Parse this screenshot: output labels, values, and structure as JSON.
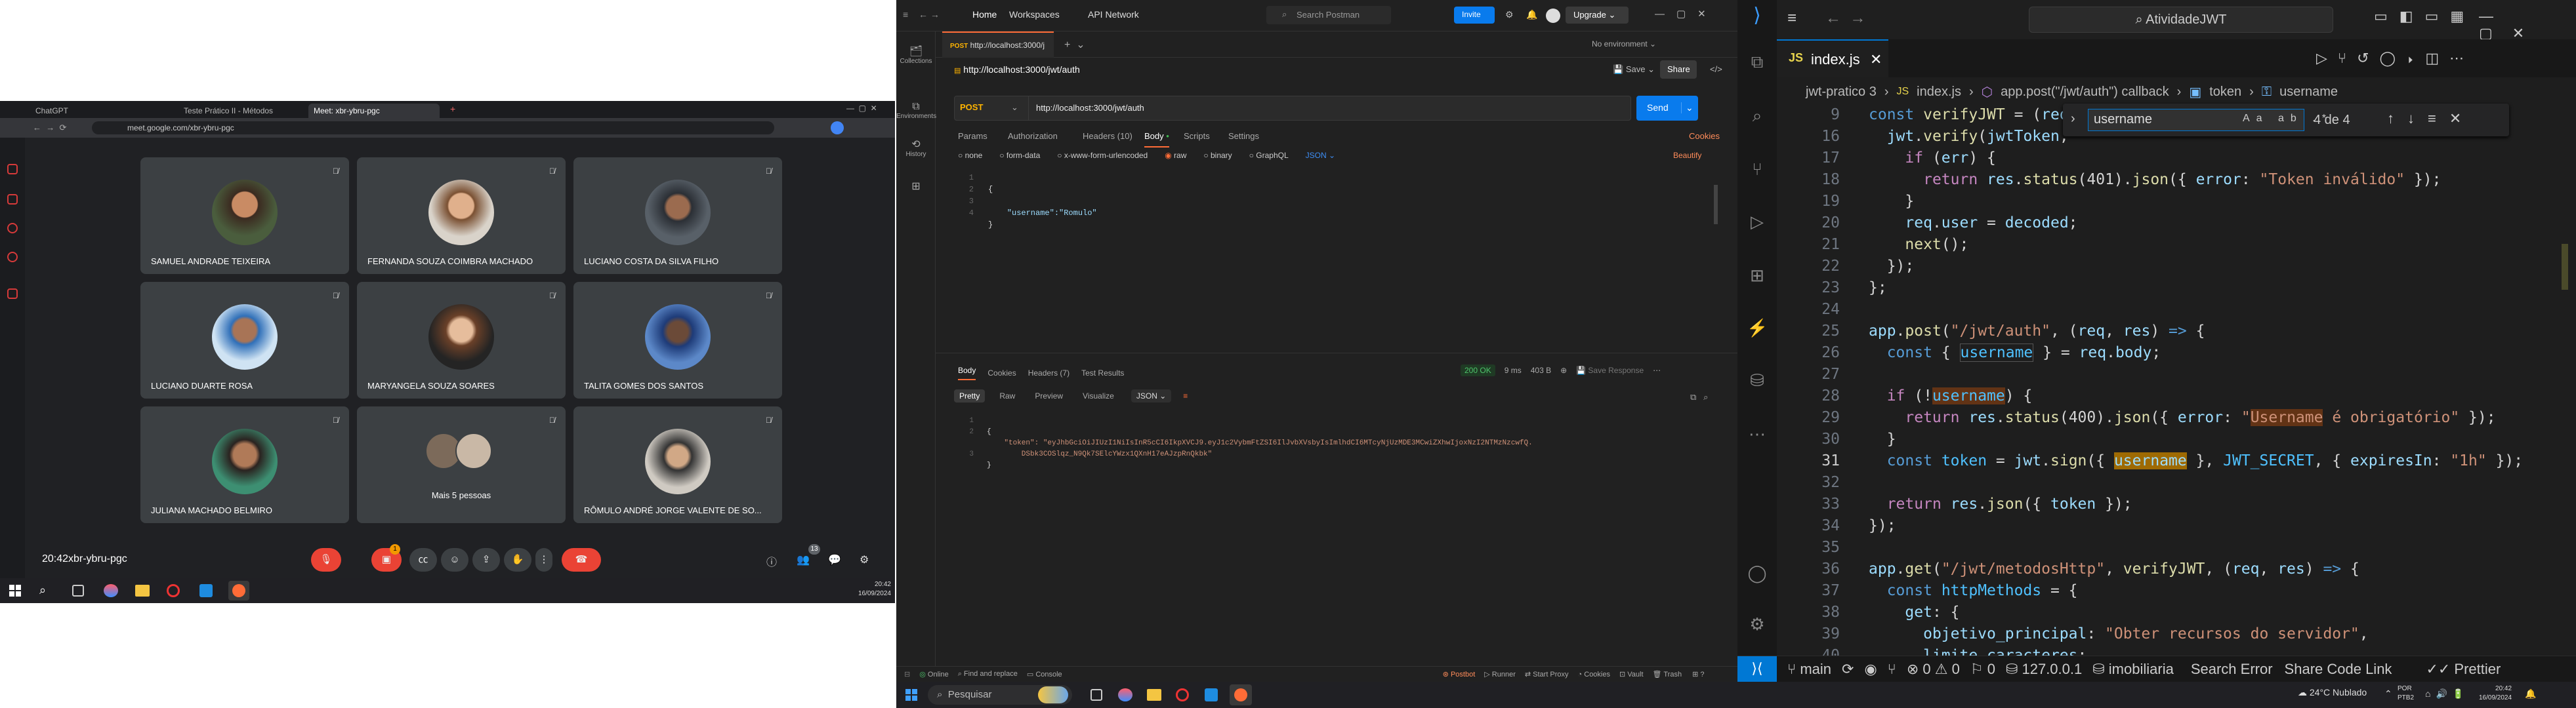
{
  "meet": {
    "tabs": [
      "ChatGPT",
      "Teste Prático II - Métodos",
      "Meet: xbr-ybru-pgc"
    ],
    "url": "meet.google.com/xbr-ybru-pgc",
    "participants": [
      "SAMUEL ANDRADE TEIXEIRA",
      "FERNANDA SOUZA COIMBRA MACHADO",
      "LUCIANO COSTA DA SILVA FILHO",
      "LUCIANO DUARTE ROSA",
      "MARYANGELA SOUZA SOARES",
      "TALITA GOMES DOS SANTOS",
      "JULIANA MACHADO BELMIRO",
      "Mais 5 pessoas",
      "RÔMULO ANDRÉ JORGE VALENTE DE SO..."
    ],
    "time": "20:42",
    "meeting_code": "xbr-ybru-pgc",
    "reactions_badge": "1",
    "people_count": "13"
  },
  "taskbar_left": {
    "time": "20:42",
    "date": "16/09/2024"
  },
  "postman": {
    "nav": {
      "home": "Home",
      "workspaces": "Workspaces",
      "api_network": "API Network",
      "search": "Search Postman",
      "invite": "Invite",
      "upgrade": "Upgrade"
    },
    "tab": {
      "method": "POST",
      "title": "http://localhost:3000/j",
      "env": "No environment"
    },
    "sidebar": [
      "Collections",
      "Environments",
      "History"
    ],
    "request_title": "http://localhost:3000/jwt/auth",
    "save": "Save",
    "share": "Share",
    "method": "POST",
    "url": "http://localhost:3000/jwt/auth",
    "send": "Send",
    "req_tabs": [
      "Params",
      "Authorization",
      "Headers (10)",
      "Body",
      "Scripts",
      "Settings"
    ],
    "cookies": "Cookies",
    "body_types": [
      "none",
      "form-data",
      "x-www-form-urlencoded",
      "raw",
      "binary",
      "GraphQL"
    ],
    "json_label": "JSON",
    "beautify": "Beautify",
    "body_lines": [
      "{",
      "",
      "    \"username\":\"Romulo\"",
      "}"
    ],
    "resp_tabs": [
      "Body",
      "Cookies",
      "Headers (7)",
      "Test Results"
    ],
    "status": "200 OK",
    "time": "9 ms",
    "size": "403 B",
    "save_response": "Save Response",
    "view_tabs": [
      "Pretty",
      "Raw",
      "Preview",
      "Visualize"
    ],
    "resp_format": "JSON",
    "resp_lines": [
      "{",
      "    \"token\": \"eyJhbGciOiJIUzI1NiIsInR5cCI6IkpXVCJ9.eyJ1c2VybmFtZSI6IlJvbXVsbyIsImlhdCI6MTcyNjUzMDE3MCwiZXhwIjoxNzI2NTMzNzcwfQ.",
      "        DSbk3COSlqz_N9Qk7SElcYWzx1QXnH17eAJzpRnQkbk\"",
      "}"
    ],
    "footer": [
      "Online",
      "Find and replace",
      "Console",
      "Postbot",
      "Runner",
      "Start Proxy",
      "Cookies",
      "Vault",
      "Trash"
    ]
  },
  "taskbar_mid": {
    "search": "Pesquisar"
  },
  "vscode": {
    "search": "AtividadeJWT",
    "tab": "index.js",
    "breadcrumb": [
      "jwt-pratico 3",
      "index.js",
      "app.post(\"/jwt/auth\") callback",
      "token",
      "username"
    ],
    "find_term": "username",
    "find_count": "4 de 4",
    "code": [
      {
        "n": "9",
        "t": "  const verifyJWT = (req,"
      },
      {
        "n": "16",
        "t": "    jwt.verify(jwtToken,"
      },
      {
        "n": "17",
        "t": "      if (err) {"
      },
      {
        "n": "18",
        "t": "        return res.status(401).json({ error: \"Token inválido\" });"
      },
      {
        "n": "19",
        "t": "      }"
      },
      {
        "n": "20",
        "t": "      req.user = decoded;"
      },
      {
        "n": "21",
        "t": "      next();"
      },
      {
        "n": "22",
        "t": "    });"
      },
      {
        "n": "23",
        "t": "  };"
      },
      {
        "n": "24",
        "t": ""
      },
      {
        "n": "25",
        "t": "  app.post(\"/jwt/auth\", (req, res) => {"
      },
      {
        "n": "26",
        "t": "    const { username } = req.body;"
      },
      {
        "n": "27",
        "t": ""
      },
      {
        "n": "28",
        "t": "    if (!username) {"
      },
      {
        "n": "29",
        "t": "      return res.status(400).json({ error: \"Username é obrigatório\" });"
      },
      {
        "n": "30",
        "t": "    }"
      },
      {
        "n": "31",
        "t": "    const token = jwt.sign({ username }, JWT_SECRET, { expiresIn: \"1h\" });"
      },
      {
        "n": "32",
        "t": ""
      },
      {
        "n": "33",
        "t": "    return res.json({ token });"
      },
      {
        "n": "34",
        "t": "  });"
      },
      {
        "n": "35",
        "t": ""
      },
      {
        "n": "36",
        "t": "  app.get(\"/jwt/metodosHttp\", verifyJWT, (req, res) => {"
      },
      {
        "n": "37",
        "t": "    const httpMethods = {"
      },
      {
        "n": "38",
        "t": "      get: {"
      },
      {
        "n": "39",
        "t": "        objetivo_principal: \"Obter recursos do servidor\","
      },
      {
        "n": "40",
        "t": "        limite_caracteres:"
      }
    ],
    "status": [
      "main",
      "0",
      "0",
      "0",
      "127.0.0.1",
      "imobiliaria",
      "Search Error",
      "Share Code Link",
      "Prettier"
    ],
    "status_warn": "0"
  },
  "taskbar_right": {
    "weather": "24°C Nublado",
    "lang": "POR PTB2",
    "time": "20:42",
    "date": "16/09/2024"
  },
  "colors": {
    "postman_orange": "#ff6c37",
    "send_blue": "#097bed",
    "vscode_blue": "#0078d4",
    "meet_red": "#ea4335"
  }
}
